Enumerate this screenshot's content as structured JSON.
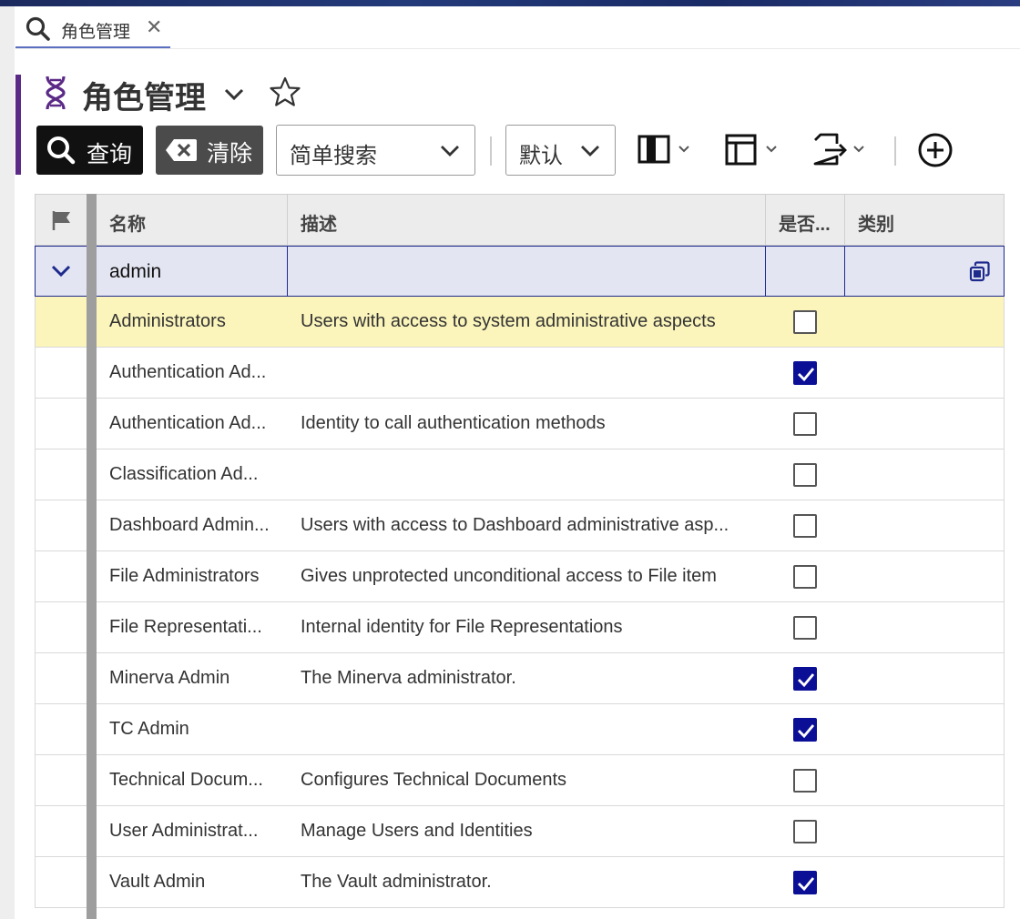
{
  "tab": {
    "label": "角色管理",
    "close": "✕"
  },
  "header": {
    "title": "角色管理"
  },
  "toolbar": {
    "query_label": "查询",
    "clear_label": "清除",
    "search_mode": "简单搜索",
    "view_mode": "默认"
  },
  "grid": {
    "columns": [
      "名称",
      "描述",
      "是否...",
      "类别"
    ],
    "group": {
      "label": "admin"
    },
    "rows": [
      {
        "name": "Administrators",
        "description": "Users with access to system administrative aspects",
        "checked": false,
        "selected": true
      },
      {
        "name": "Authentication Ad...",
        "description": "",
        "checked": true,
        "selected": false
      },
      {
        "name": "Authentication Ad...",
        "description": "Identity to call authentication methods",
        "checked": false,
        "selected": false
      },
      {
        "name": "Classification Ad...",
        "description": "",
        "checked": false,
        "selected": false
      },
      {
        "name": "Dashboard Admin...",
        "description": "Users with access to Dashboard administrative asp...",
        "checked": false,
        "selected": false
      },
      {
        "name": "File Administrators",
        "description": "Gives unprotected unconditional access to File item",
        "checked": false,
        "selected": false
      },
      {
        "name": "File Representati...",
        "description": "Internal identity for File Representations",
        "checked": false,
        "selected": false
      },
      {
        "name": "Minerva Admin",
        "description": "The Minerva administrator.",
        "checked": true,
        "selected": false
      },
      {
        "name": "TC Admin",
        "description": "",
        "checked": true,
        "selected": false
      },
      {
        "name": "Technical Docum...",
        "description": "Configures Technical Documents",
        "checked": false,
        "selected": false
      },
      {
        "name": "User Administrat...",
        "description": "Manage Users and Identities",
        "checked": false,
        "selected": false
      },
      {
        "name": "Vault Admin",
        "description": "The Vault administrator.",
        "checked": true,
        "selected": false
      }
    ]
  },
  "colors": {
    "accent": "#5b2a86",
    "checked": "#0a0f96",
    "selected_row": "#fbf5bb",
    "group_row": "#e3e5f2",
    "query_button": "#111111",
    "clear_button": "#4b4b4b"
  }
}
